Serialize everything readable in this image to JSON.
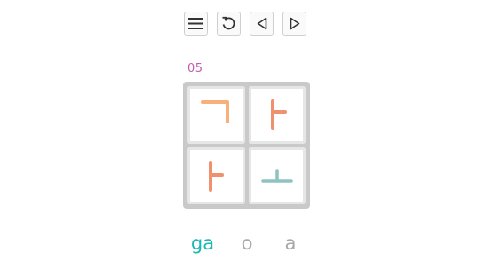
{
  "toolbar": {
    "buttons": [
      {
        "icon": "menu-icon"
      },
      {
        "icon": "restart-icon"
      },
      {
        "icon": "previous-icon"
      },
      {
        "icon": "next-icon"
      }
    ]
  },
  "level": "05",
  "board": {
    "tiles": [
      {
        "jamo": "ㄱ",
        "color": "#f7b07a"
      },
      {
        "jamo": "ㅏ",
        "color": "#f0916e"
      },
      {
        "jamo": "ㅏ",
        "color": "#f0916e"
      },
      {
        "jamo": "ㅗ",
        "color": "#8fc3c0"
      }
    ]
  },
  "answers": [
    {
      "text": "ga",
      "state": "solved",
      "color": "#1ab8b3"
    },
    {
      "text": "o",
      "state": "pending",
      "color": "#a8a8a8"
    },
    {
      "text": "a",
      "state": "pending",
      "color": "#a8a8a8"
    }
  ]
}
